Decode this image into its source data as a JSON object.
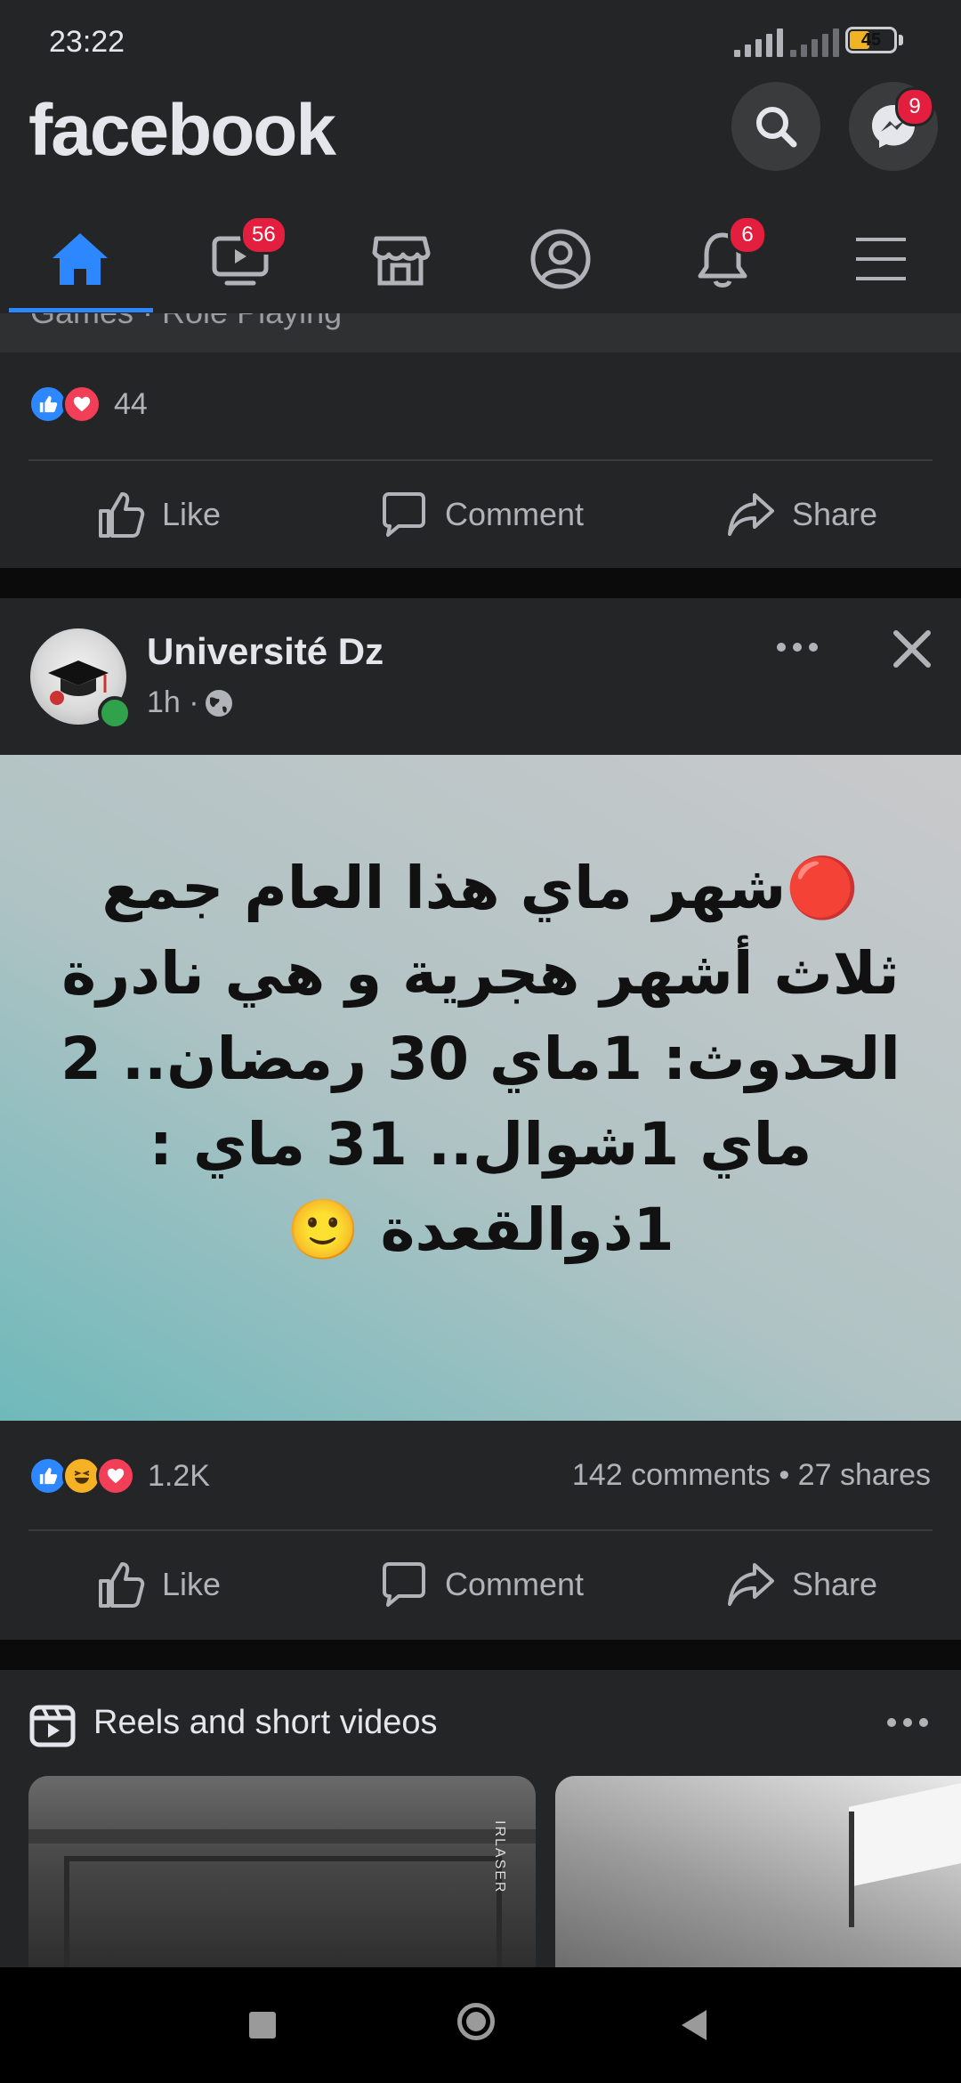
{
  "status_bar": {
    "time": "23:22",
    "battery": "45"
  },
  "header": {
    "logo": "facebook",
    "messenger_badge": "9"
  },
  "tabs": [
    {
      "name": "home",
      "active": true,
      "badge": ""
    },
    {
      "name": "watch",
      "badge": "56"
    },
    {
      "name": "marketplace",
      "badge": ""
    },
    {
      "name": "profile",
      "badge": ""
    },
    {
      "name": "notifications",
      "badge": "6"
    },
    {
      "name": "menu",
      "badge": ""
    }
  ],
  "previous_post": {
    "partial_text": "Games · Role Playing",
    "reaction_count": "44",
    "actions": {
      "like": "Like",
      "comment": "Comment",
      "share": "Share"
    }
  },
  "post": {
    "author": "Université Dz",
    "time": "1h · ",
    "image_text": "🔴شهر ماي هذا العام جمع ثلاث أشهر هجرية و هي نادرة الحدوث: 1ماي 30 رمضان.. 2 ماي 1شوال.. 31 ماي : 1ذوالقعدة 🙂",
    "reaction_count": "1.2K",
    "comments_shares": "142 comments • 27 shares",
    "actions": {
      "like": "Like",
      "comment": "Comment",
      "share": "Share"
    },
    "background_colors": [
      "#6fb9bb",
      "#c9c9cb"
    ]
  },
  "reels": {
    "title": "Reels and short videos",
    "thumb_watermark": "IRLASER"
  },
  "colors": {
    "accent": "#2d88ff",
    "badge": "#e41e3f",
    "card": "#242526"
  }
}
